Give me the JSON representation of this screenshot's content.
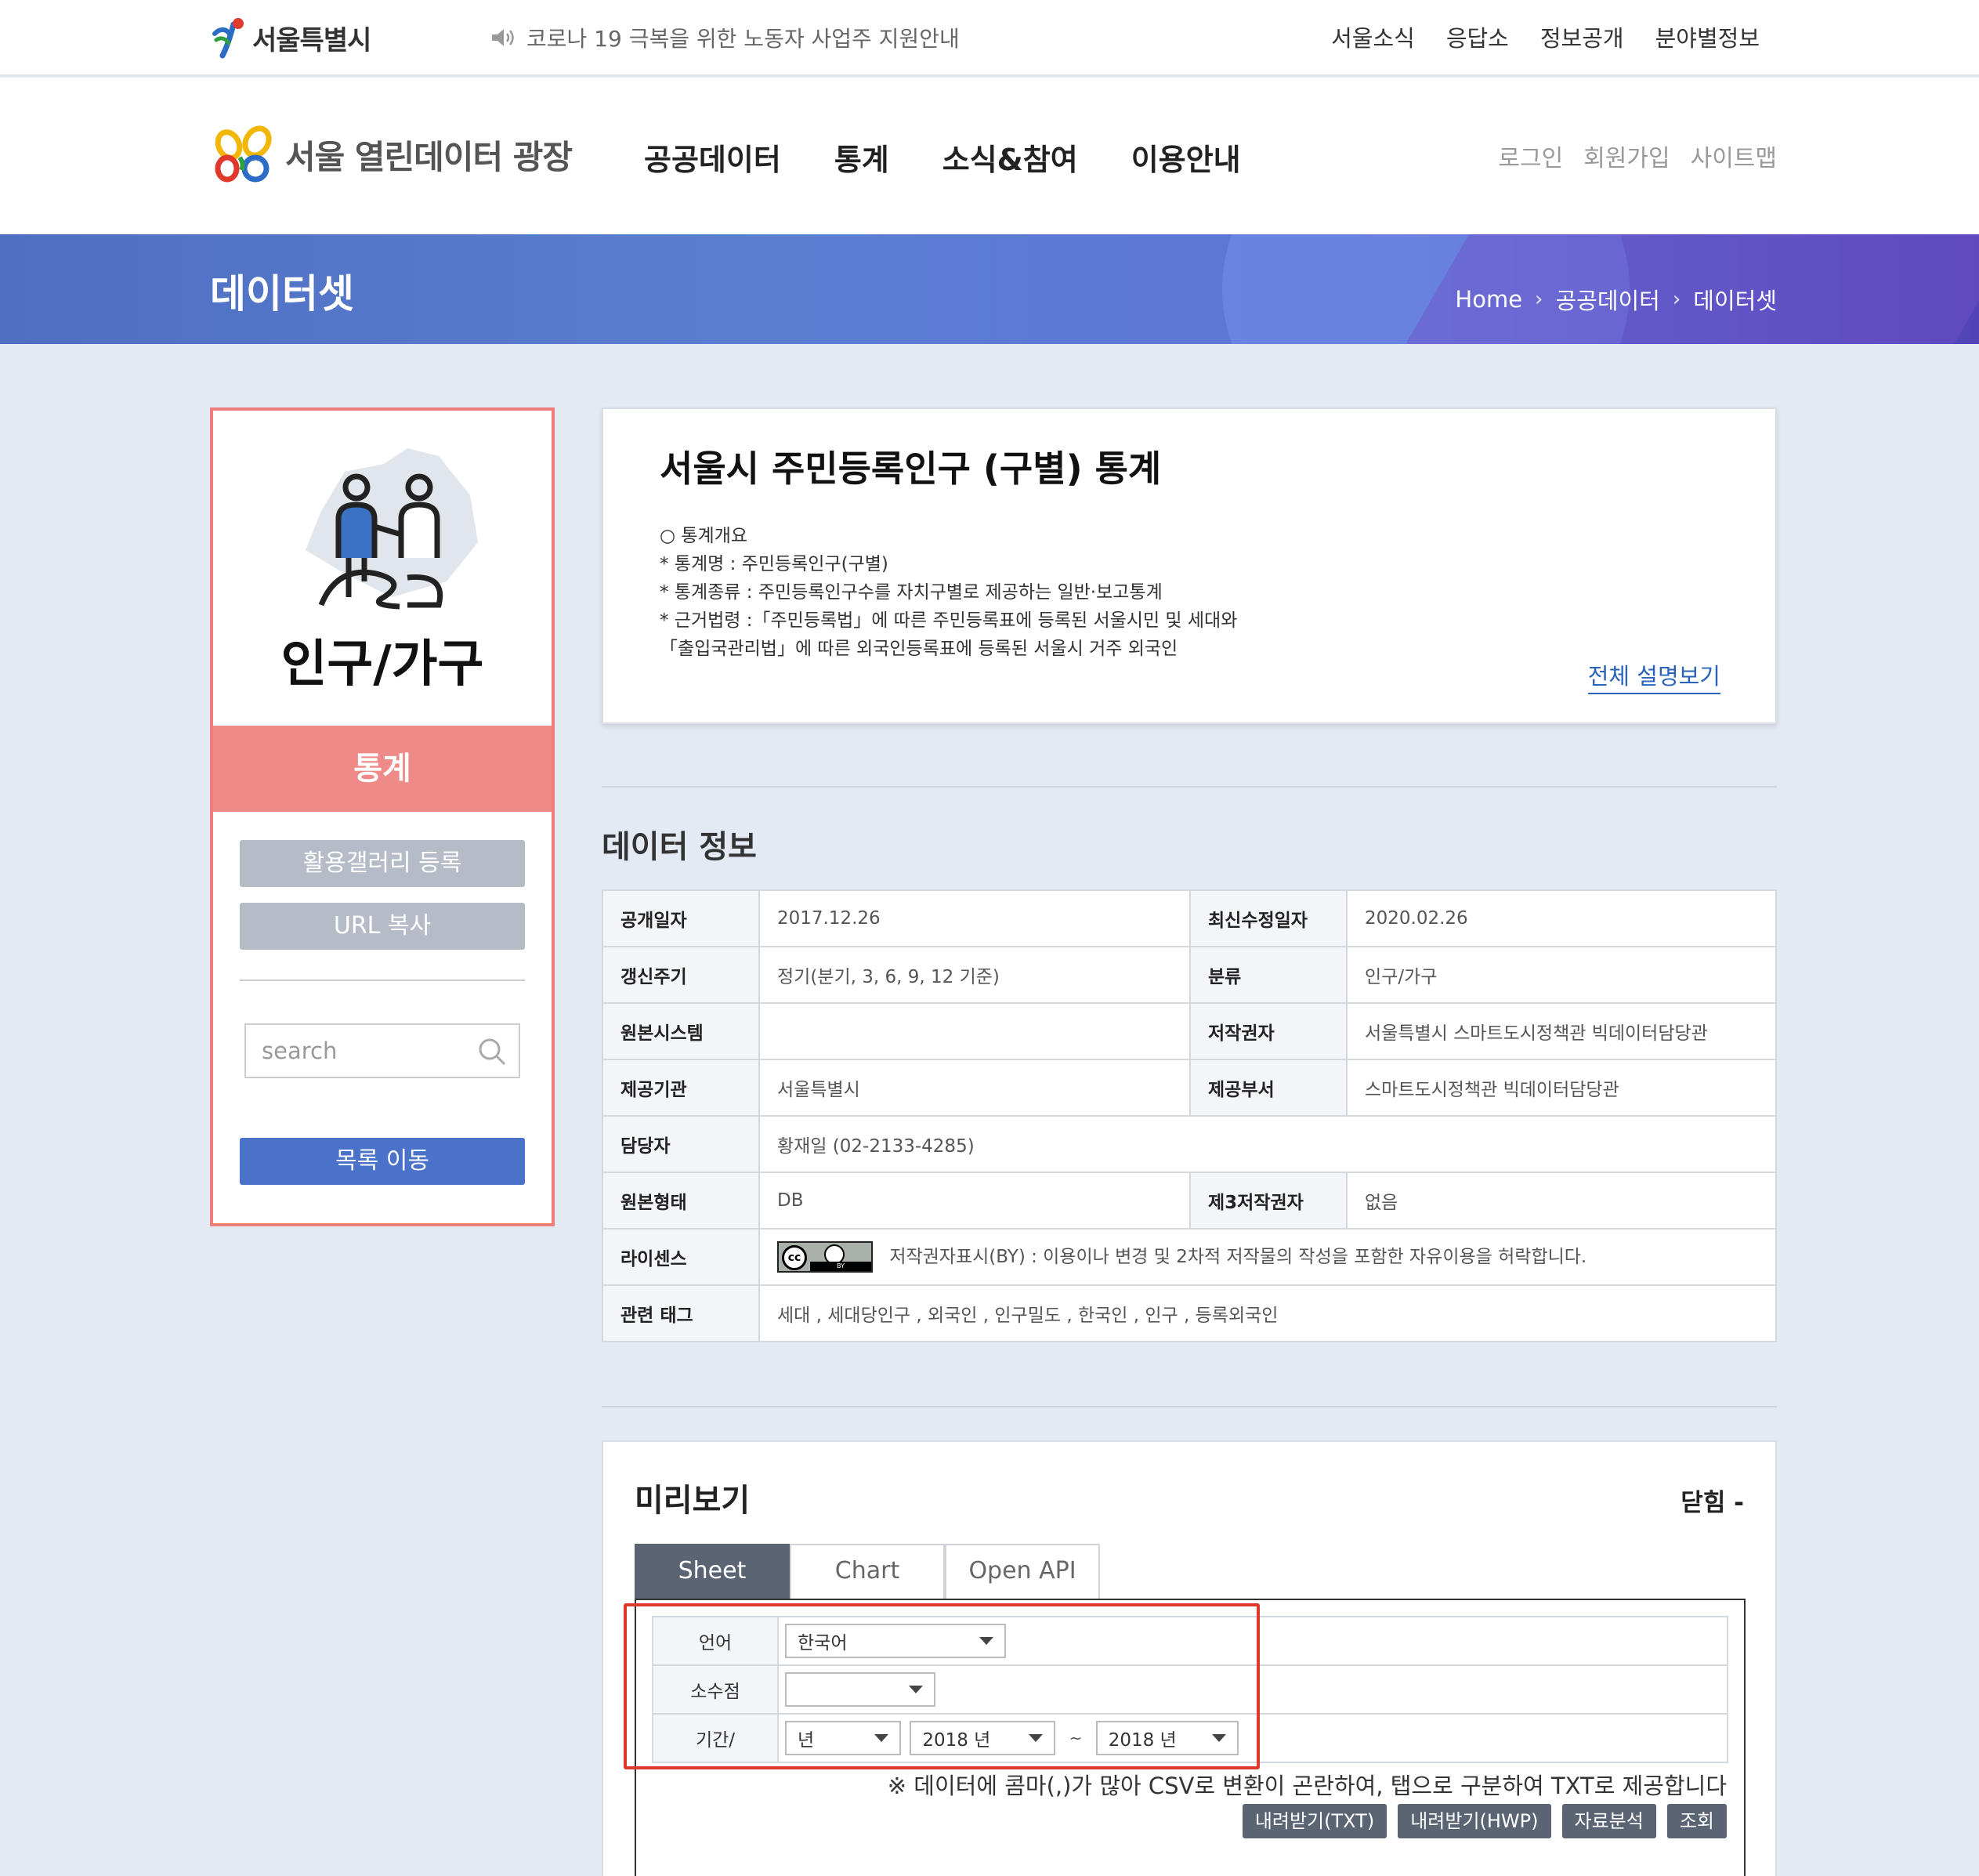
{
  "top_bar": {
    "city_logo_text": "서울특별시",
    "notice": "코로나 19 극복을 위한 노동자 사업주 지원안내",
    "links": [
      "서울소식",
      "응답소",
      "정보공개",
      "분야별정보"
    ]
  },
  "header": {
    "logo_text": "서울 열린데이터 광장",
    "gnb": [
      "공공데이터",
      "통계",
      "소식&참여",
      "이용안내"
    ],
    "member_links": [
      "로그인",
      "회원가입",
      "사이트맵"
    ]
  },
  "hero": {
    "title": "데이터셋",
    "breadcrumb": [
      "Home",
      "공공데이터",
      "데이터셋"
    ]
  },
  "sidebar": {
    "category": "인구/가구",
    "type": "통계",
    "gallery_button": "활용갤러리 등록",
    "url_button": "URL 복사",
    "search_placeholder": "search",
    "list_button": "목록 이동"
  },
  "description": {
    "title": "서울시 주민등록인구 (구별) 통계",
    "lines": [
      "○ 통계개요",
      "* 통계명 : 주민등록인구(구별)",
      "* 통계종류 : 주민등록인구수를 자치구별로 제공하는 일반·보고통계",
      "* 근거법령 :「주민등록법」에 따른 주민등록표에 등록된 서울시민 및 세대와",
      "「출입국관리법」에 따른 외국인등록표에 등록된 서울시 거주 외국인"
    ],
    "more_link": "전체 설명보기"
  },
  "data_info": {
    "title": "데이터 정보",
    "rows": [
      {
        "k1": "공개일자",
        "v1": "2017.12.26",
        "k2": "최신수정일자",
        "v2": "2020.02.26"
      },
      {
        "k1": "갱신주기",
        "v1": "정기(분기, 3, 6, 9, 12 기준)",
        "k2": "분류",
        "v2": "인구/가구"
      },
      {
        "k1": "원본시스템",
        "v1": "",
        "k2": "저작권자",
        "v2": "서울특별시 스마트도시정책관 빅데이터담당관"
      },
      {
        "k1": "제공기관",
        "v1": "서울특별시",
        "k2": "제공부서",
        "v2": "스마트도시정책관 빅데이터담당관"
      },
      {
        "k1": "담당자",
        "v1": "황재일 (02-2133-4285)"
      },
      {
        "k1": "원본형태",
        "v1": "DB",
        "k2": "제3저작권자",
        "v2": "없음"
      },
      {
        "k1": "라이센스",
        "v1": "저작권자표시(BY) : 이용이나 변경 및 2차적 저작물의 작성을 포함한 자유이용을 허락합니다."
      },
      {
        "k1": "관련 태그",
        "v1": "세대 , 세대당인구 , 외국인 , 인구밀도 , 한국인 , 인구 , 등록외국인"
      }
    ],
    "license_badge": {
      "cc": "cc",
      "by": "BY"
    }
  },
  "preview": {
    "title": "미리보기",
    "collapse": "닫힘 -",
    "tabs": [
      "Sheet",
      "Chart",
      "Open API"
    ],
    "options": {
      "language_label": "언어",
      "language_value": "한국어",
      "decimal_label": "소수점",
      "decimal_value": "",
      "period_label": "기간/",
      "period_unit": "년",
      "period_from": "2018 년",
      "period_tilde": "~",
      "period_to": "2018 년"
    },
    "csv_note": "※ 데이터에 콤마(,)가 많아 CSV로 변환이 곤란하여, 탭으로 구분하여 TXT로 제공합니다",
    "buttons": [
      "내려받기(TXT)",
      "내려받기(HWP)",
      "자료분석",
      "조회"
    ]
  },
  "colors": {
    "accent_blue": "#4a72c9",
    "category_red": "#ee8a87",
    "highlight_red": "#e0392b"
  }
}
